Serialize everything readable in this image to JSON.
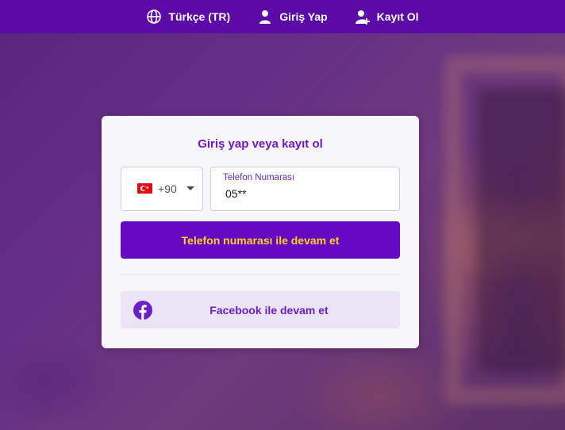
{
  "topbar": {
    "items": [
      {
        "label": "Türkçe (TR)",
        "icon": "globe-icon"
      },
      {
        "label": "Giriş Yap",
        "icon": "user-icon"
      },
      {
        "label": "Kayıt Ol",
        "icon": "user-plus-icon"
      }
    ]
  },
  "card": {
    "title": "Giriş yap veya kayıt ol",
    "country": {
      "dial_code": "+90",
      "flag": "turkey-flag-icon"
    },
    "phone": {
      "label": "Telefon Numarası",
      "value": "05**"
    },
    "primary_button": "Telefon numarası ile devam et",
    "facebook_button": "Facebook ile devam et"
  },
  "colors": {
    "topbar": "#5b0aa8",
    "accent": "#6408c3",
    "button_text": "#ffd21f",
    "title": "#7415c7",
    "facebook_bg": "#ebe3f6",
    "facebook_icon": "#6a22c4"
  }
}
